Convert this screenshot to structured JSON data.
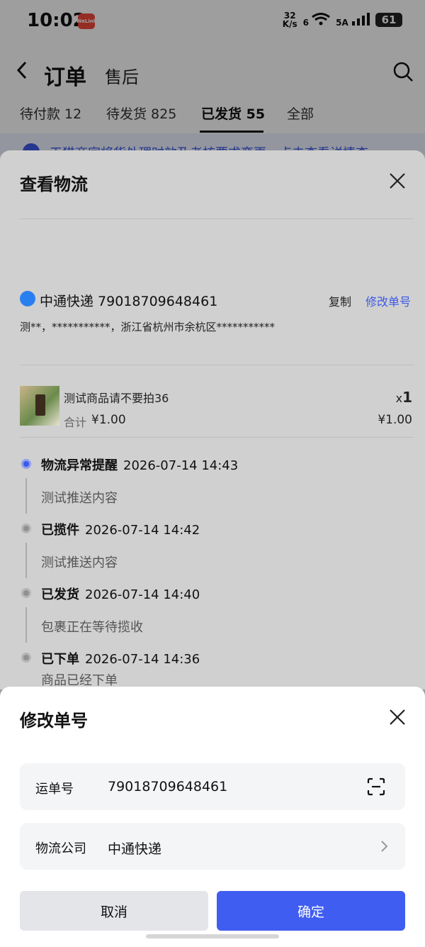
{
  "status_bar": {
    "time": "10:02",
    "app_badge": "WeLink",
    "net_speed_top": "32",
    "net_speed_bottom": "K/s",
    "wifi_label": "6",
    "signal_label": "5A",
    "battery": "61"
  },
  "header": {
    "title": "订单",
    "subtitle": "售后",
    "tabs": [
      {
        "label": "待付款 12"
      },
      {
        "label": "待发货 825"
      },
      {
        "label": "已发货 55"
      },
      {
        "label": "全部"
      }
    ],
    "notice": "天猫商家将货处理时效及考核要求变更，点击查看详情查"
  },
  "logistics": {
    "title": "查看物流",
    "carrier": "中通快递 79018709648461",
    "copy_label": "复制",
    "modify_label": "修改单号",
    "address": "测**，***********，浙江省杭州市余杭区***********",
    "product": {
      "name": "测试商品请不要拍36",
      "qty_prefix": "x",
      "qty": "1",
      "total_label": "合计",
      "total": "¥1.00",
      "price": "¥1.00"
    },
    "timeline": [
      {
        "title": "物流异常提醒",
        "time": "2026-07-14 14:43",
        "desc": "测试推送内容"
      },
      {
        "title": "已揽件",
        "time": "2026-07-14 14:42",
        "desc": "测试推送内容"
      },
      {
        "title": "已发货",
        "time": "2026-07-14 14:40",
        "desc": "包裹正在等待揽收"
      },
      {
        "title": "已下单",
        "time": "2026-07-14 14:36",
        "desc": "商品已经下单"
      }
    ]
  },
  "modify_sheet": {
    "title": "修改单号",
    "tracking_label": "运单号",
    "tracking_value": "79018709648461",
    "company_label": "物流公司",
    "company_value": "中通快递",
    "cancel_label": "取消",
    "confirm_label": "确定"
  },
  "colors": {
    "accent": "#3f5df0",
    "link": "#3d59e6"
  }
}
